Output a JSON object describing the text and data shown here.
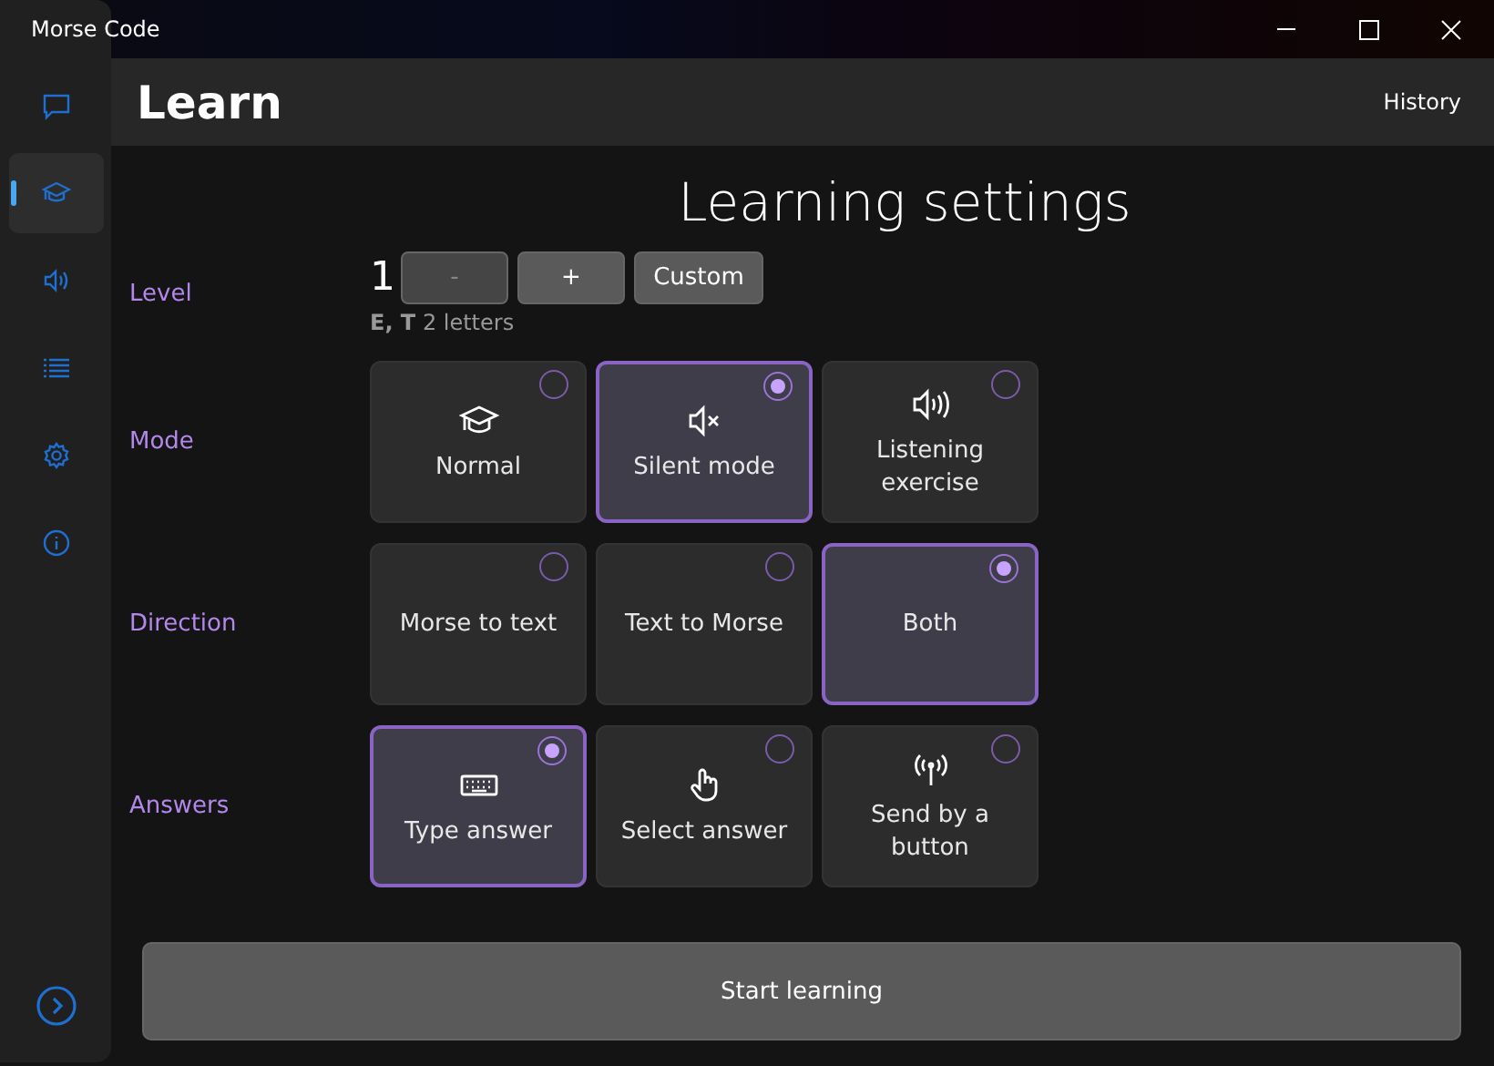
{
  "window": {
    "title": "Morse Code"
  },
  "nav": [
    {
      "selected": false
    },
    {
      "selected": true
    },
    {
      "selected": false
    },
    {
      "selected": false
    },
    {
      "selected": false
    },
    {
      "selected": false
    }
  ],
  "header": {
    "title": "Learn",
    "link": "History"
  },
  "heading": "Learning settings",
  "level": {
    "label": "Level",
    "value": "1",
    "buttons": [
      {
        "label": "-",
        "disabled": true
      },
      {
        "label": "+",
        "disabled": false
      },
      {
        "label": "Custom",
        "disabled": false
      }
    ],
    "letters": "**E, T** 2 letters"
  },
  "groups": [
    {
      "label": "Mode",
      "options": [
        {
          "label": "Normal",
          "selected": false
        },
        {
          "label": "Silent mode",
          "selected": true
        },
        {
          "label": "Listening exercise",
          "selected": false
        }
      ]
    },
    {
      "label": "Direction",
      "options": [
        {
          "label": "Morse to text",
          "selected": false
        },
        {
          "label": "Text to Morse",
          "selected": false
        },
        {
          "label": "Both",
          "selected": true
        }
      ]
    },
    {
      "label": "Answers",
      "options": [
        {
          "label": "Type answer",
          "selected": true
        },
        {
          "label": "Select answer",
          "selected": false
        },
        {
          "label": "Send by a button",
          "selected": false
        }
      ]
    }
  ],
  "start_button": "Start learning"
}
